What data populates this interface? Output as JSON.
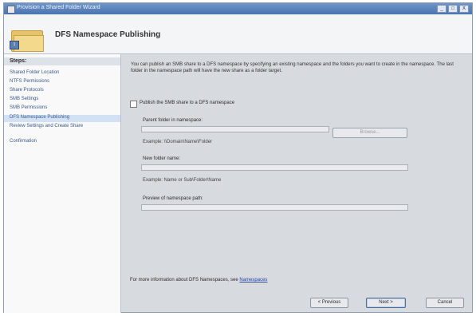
{
  "window": {
    "title": "Provision a Shared Folder Wizard",
    "controls": [
      "_",
      "□",
      "X"
    ]
  },
  "header": {
    "title": "DFS Namespace Publishing",
    "badge": "1"
  },
  "sidebar": {
    "heading": "Steps:",
    "items": [
      {
        "label": "Shared Folder Location"
      },
      {
        "label": "NTFS Permissions"
      },
      {
        "label": "Share Protocols"
      },
      {
        "label": "SMB Settings"
      },
      {
        "label": "SMB Permissions"
      },
      {
        "label": "DFS Namespace Publishing"
      },
      {
        "label": "Review Settings and Create Share"
      },
      {
        "label": "Confirmation"
      }
    ]
  },
  "content": {
    "description": "You can publish an SMB share to a DFS namespace by specifying an existing namespace and the folders you want to create in the namespace. The last folder in the namespace path will have the new share as a folder target.",
    "checkbox_label": "Publish the SMB share to a DFS namespace",
    "parent_folder_label": "Parent folder in namespace:",
    "browse_label": "Browse...",
    "example1": "Example: \\\\Domain\\Name\\Folder",
    "new_folder_label": "New folder name:",
    "example2": "Example: Name or Sub\\Folder\\Name",
    "preview_label": "Preview of namespace path:",
    "footer_text": "For more information about DFS Namespaces, see",
    "footer_link": "Namespaces"
  },
  "buttons": {
    "previous": "< Previous",
    "next": "Next >",
    "cancel": "Cancel"
  }
}
